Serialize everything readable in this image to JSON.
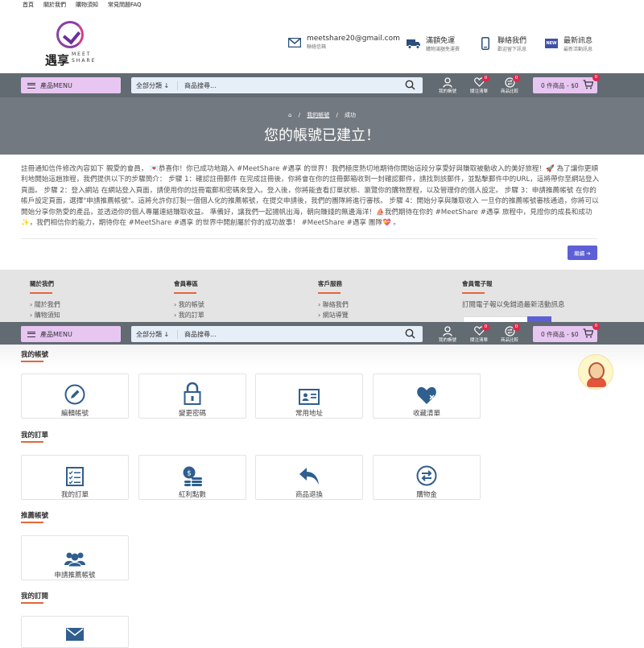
{
  "top_links": [
    "首頁",
    "關於我們",
    "購物須知",
    "常見問題FAQ"
  ],
  "logo": {
    "cn": "遇享",
    "en_line1": "MEET",
    "en_line2": "SHARE"
  },
  "header_info": [
    {
      "icon": "email-icon",
      "title": "meetshare20@gmail.com",
      "sub": "聯絡信箱"
    },
    {
      "icon": "truck-icon",
      "title": "滿額免運",
      "sub": "購物滿額免運費"
    },
    {
      "icon": "phone-icon",
      "title": "聯絡我們",
      "sub": "歡迎留下訊息"
    },
    {
      "icon": "new-badge-icon",
      "title": "最新訊息",
      "sub": "最新活動訊息"
    }
  ],
  "navbar": {
    "menu_label": "產品MENU",
    "category": "全部分類 ↓",
    "search_placeholder": "商品搜尋...",
    "icons": [
      {
        "name": "my-account",
        "label": "我的帳號",
        "badge": ""
      },
      {
        "name": "wishlist",
        "label": "關注清單",
        "badge": "0"
      },
      {
        "name": "compare",
        "label": "商品比較",
        "badge": "0"
      }
    ],
    "cart_label": "0 件商品 - $0",
    "cart_badge": "0"
  },
  "hero": {
    "breadcrumb_home": "⌂",
    "breadcrumb_sep": "/",
    "breadcrumb_account": "我的帳號",
    "breadcrumb_current": "成功",
    "title": "您的帳號已建立！"
  },
  "mail_text": "註冊通知信件修改內容如下 親愛的會員， 💌恭喜你！你已成功地踏入 #MeetShare #遇享 的世界！我們極度熱切地期待你開始這段分享愛好與賺取被動收入的美好旅程！🚀 為了讓你更順利地開始這趟旅程，我們提供以下的步驟簡介： 步驟 1：確認註冊郵件 在完成註冊後，你將會在你的註冊郵箱收到一封確認郵件，請找到該郵件，並點擊郵件中的URL，這將帶你至網站登入頁面。 步驟 2：登入網站 在網站登入頁面，請使用你的註冊電郵和密碼來登入。登入後，你將能查看訂單狀態、瀏覽你的購物歷程，以及管理你的個人設定。 步驟 3：申請推薦帳號 在你的帳戶設定頁面，選擇\"申請推薦帳號\"。這將允許你訂製一個個人化的推薦帳號，在提交申請後，我們的團隊將進行審核。 步驟 4：開始分享與賺取收入 一旦你的推薦帳號審核通過，你將可以開始分享你熱愛的產品，並透過你的個人專屬連結賺取收益。 準備好，讓我們一起揚帆出海，朝向賺錢的無邊海洋！⛵我們期待在你的 #MeetShare #遇享 旅程中，見證你的成長和成功✨，我們相信你的能力，期待你在 #MeetShare #遇享 的世界中開創屬於你的成功故事！ #MeetShare #遇享 團隊💝 。",
  "login_button": "繼續 ➔",
  "footer": {
    "cols": [
      {
        "title": "關於我們",
        "items": [
          "關於我們",
          "購物須知"
        ]
      },
      {
        "title": "會員專區",
        "items": [
          "我的帳號",
          "我的訂單"
        ]
      },
      {
        "title": "客戶服務",
        "items": [
          "聯絡我們",
          "網站導覽"
        ]
      }
    ],
    "newsletter_title": "會員電子報",
    "newsletter_text": "訂閱電子報以免錯過最新活動訊息"
  },
  "sections": [
    {
      "title": "我的帳號",
      "cards": [
        {
          "icon": "pencil-icon",
          "label": "編輯帳號"
        },
        {
          "icon": "lock-icon",
          "label": "變更密碼"
        },
        {
          "icon": "address-card-icon",
          "label": "常用地址"
        },
        {
          "icon": "heart-icon",
          "label": "收藏清單"
        }
      ]
    },
    {
      "title": "我的訂單",
      "cards": [
        {
          "icon": "checklist-icon",
          "label": "我的訂單"
        },
        {
          "icon": "coins-icon",
          "label": "紅利點數"
        },
        {
          "icon": "return-arrow-icon",
          "label": "商品退換"
        },
        {
          "icon": "exchange-icon",
          "label": "購物金"
        }
      ]
    },
    {
      "title": "推薦帳號",
      "cards": [
        {
          "icon": "users-icon",
          "label": "申請推薦帳號"
        }
      ]
    },
    {
      "title": "我的訂閱",
      "cards": [
        {
          "icon": "envelope-icon",
          "label": ""
        }
      ]
    }
  ],
  "colors": {
    "accent": "#e0683a",
    "navbar": "#626a72",
    "pill": "#e8c6f2",
    "icon_blue": "#2f5e8f",
    "button": "#5d5fd6"
  }
}
